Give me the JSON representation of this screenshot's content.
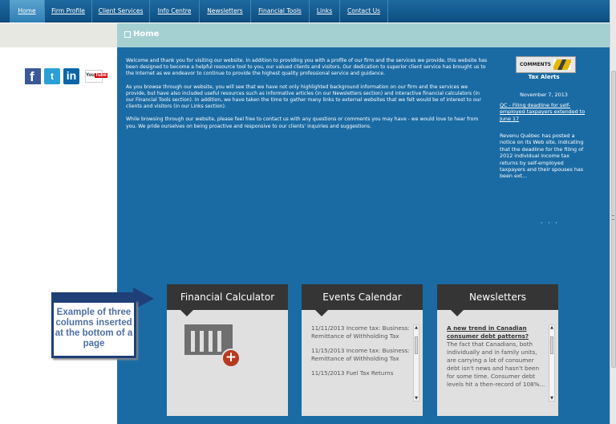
{
  "nav": {
    "items": [
      "Home",
      "Firm Profile",
      "Client Services",
      "Info Centre",
      "Newsletters",
      "Financial Tools",
      "Links",
      "Contact Us"
    ]
  },
  "social": {
    "facebook": "f",
    "twitter": "t",
    "linkedin": "in",
    "youtube_you": "You",
    "youtube_tube": "Tube"
  },
  "page": {
    "title": "Home",
    "paragraphs": [
      "Welcome and thank you for visiting our website. In addition to providing you with a profile of our firm and the services we provide, this website has been designed to become a helpful resource tool to you, our valued clients and visitors. Our dedication to superior client service has brought us to the Internet as we endeavor to continue to provide the highest quality professional service and guidance.",
      "As you browse through our website, you will see that we have not only highlighted background information on our firm and the services we provide, but have also included useful resources such as informative articles (in our Newsletters section) and interactive financial calculators (in our Financial Tools section). In addition, we have taken the time to gather many links to external websites that we felt would be of interest to our clients and visitors (in our Links section).",
      "While browsing through our website, please feel free to contact us with any questions or comments you may have - we would love to hear from you. We pride ourselves on being proactive and responsive to our clients' inquiries and suggestions."
    ]
  },
  "alerts": {
    "button_label": "COMMENTS",
    "heading": "Tax Alerts",
    "date": "November 7, 2013",
    "link": "QC - Filing deadline for self-employed taxpayers extended to June 17",
    "summary": "Revenu Québec has posted a notice on its Web site, indicating that the deadline for the filing of 2012 individual income tax returns by self-employed taxpayers and their spouses has been ext...",
    "more": ". . ."
  },
  "columns": {
    "calculator": {
      "title": "Financial Calculator"
    },
    "events": {
      "title": "Events Calendar",
      "items": [
        "11/11/2013 Income tax: Business: Remittance of Withholding Tax",
        "11/15/2013 Income tax: Business: Remittance of Withholding Tax",
        "11/15/2013 Fuel Tax Returns"
      ]
    },
    "newsletters": {
      "title": "Newsletters",
      "article_title": "A new trend in Canadian consumer debt patterns?",
      "article_body": "The fact that Canadians, both individually and in family units, are carrying a lot of consumer debt isn't news and hasn't been for some time. Consumer debt levels hit a then-record of 108%..."
    }
  },
  "callout": {
    "text": "Example of three columns inserted at the bottom of a page"
  },
  "colors": {
    "nav": "#1d6aa0",
    "main_bg": "#1a6ba4",
    "title_bar": "#a4d0d2",
    "column_header": "#353535",
    "callout": "#1e3f78"
  }
}
